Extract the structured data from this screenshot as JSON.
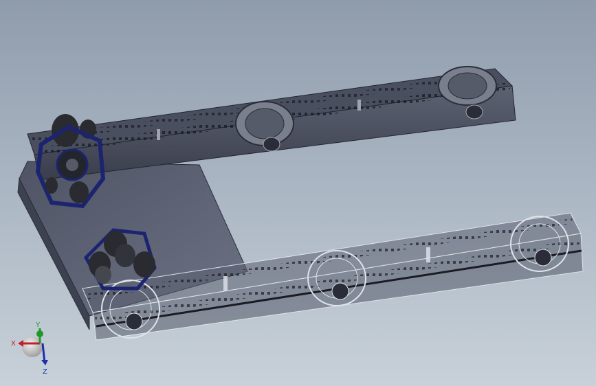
{
  "triad": {
    "x_label": "X",
    "y_label": "Y",
    "z_label": "Z",
    "x_color": "#c0202a",
    "y_color": "#1f9a2a",
    "z_color": "#1c2fb0"
  },
  "colors": {
    "background_top": "#8f9cac",
    "background_bottom": "#c8d1d9",
    "frame_dark": "#3b3f4e",
    "frame_light": "#6b7080",
    "plate": "#5c6172",
    "sprocket_blue": "#1c2470",
    "wireframe": "#dfe3ea"
  },
  "icons": {
    "view_triad": "axis-triad-icon",
    "drive_sprocket": "sprocket-gear-icon",
    "roller": "roller-wheel-icon"
  }
}
